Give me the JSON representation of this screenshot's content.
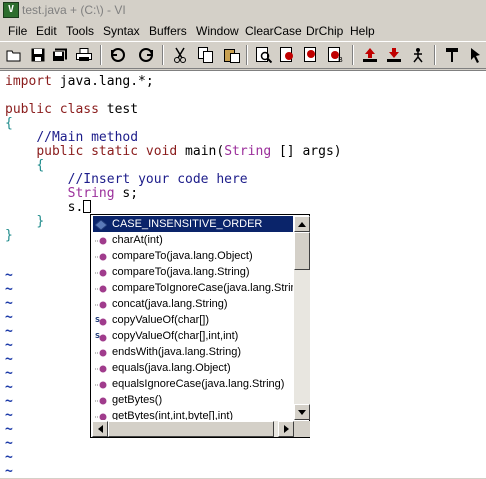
{
  "window": {
    "title": "test.java + (C:\\) - VI"
  },
  "menu": [
    "File",
    "Edit",
    "Tools",
    "Syntax",
    "Buffers",
    "Window",
    "ClearCase",
    "DrChip",
    "Help"
  ],
  "toolbar": {
    "buttons": [
      "open-icon",
      "save-icon",
      "save-all-icon",
      "print-icon",
      "undo-icon",
      "redo-icon",
      "cut-icon",
      "copy-icon",
      "paste-icon",
      "find-icon",
      "find-next-icon",
      "find-prev-icon",
      "replace-icon",
      "load-session-icon",
      "save-session-icon",
      "run-script-icon",
      "make-icon",
      "tags-icon"
    ]
  },
  "code": {
    "import_kw": "import",
    "import_rest": " java.lang.*;",
    "public_kw": "public",
    "class_kw": "class",
    "class_name": "test",
    "open_brace": "{",
    "comment_main": "//Main method",
    "static_kw": "static",
    "void_kw": "void",
    "main_sig_a": "main(",
    "string_type": "String",
    "main_sig_b": " [] args)",
    "comment_insert": "//Insert your code here",
    "string_decl_rest": " s;",
    "s_dot": "s.",
    "close_brace": "}",
    "tilde": "~"
  },
  "completion": {
    "items": [
      {
        "label": "CASE_INSENSITIVE_ORDER",
        "icon": "field-icon",
        "selected": true
      },
      {
        "label": "charAt(int)",
        "icon": "method-icon"
      },
      {
        "label": "compareTo(java.lang.Object)",
        "icon": "method-icon"
      },
      {
        "label": "compareTo(java.lang.String)",
        "icon": "method-icon"
      },
      {
        "label": "compareToIgnoreCase(java.lang.String)",
        "icon": "method-icon"
      },
      {
        "label": "concat(java.lang.String)",
        "icon": "method-icon"
      },
      {
        "label": "copyValueOf(char[])",
        "icon": "static-method-icon"
      },
      {
        "label": "copyValueOf(char[],int,int)",
        "icon": "static-method-icon"
      },
      {
        "label": "endsWith(java.lang.String)",
        "icon": "method-icon"
      },
      {
        "label": "equals(java.lang.Object)",
        "icon": "method-icon"
      },
      {
        "label": "equalsIgnoreCase(java.lang.String)",
        "icon": "method-icon"
      },
      {
        "label": "getBytes()",
        "icon": "method-icon"
      },
      {
        "label": "getBytes(int,int,byte[],int)",
        "icon": "method-icon"
      }
    ]
  },
  "colors": {
    "keyword": "#8a1c1c",
    "type": "#9b2f9b",
    "comment": "#1c1c8a",
    "brace": "#1c8a8a",
    "tilde": "#1c3aa8",
    "selection": "#0a246a"
  }
}
